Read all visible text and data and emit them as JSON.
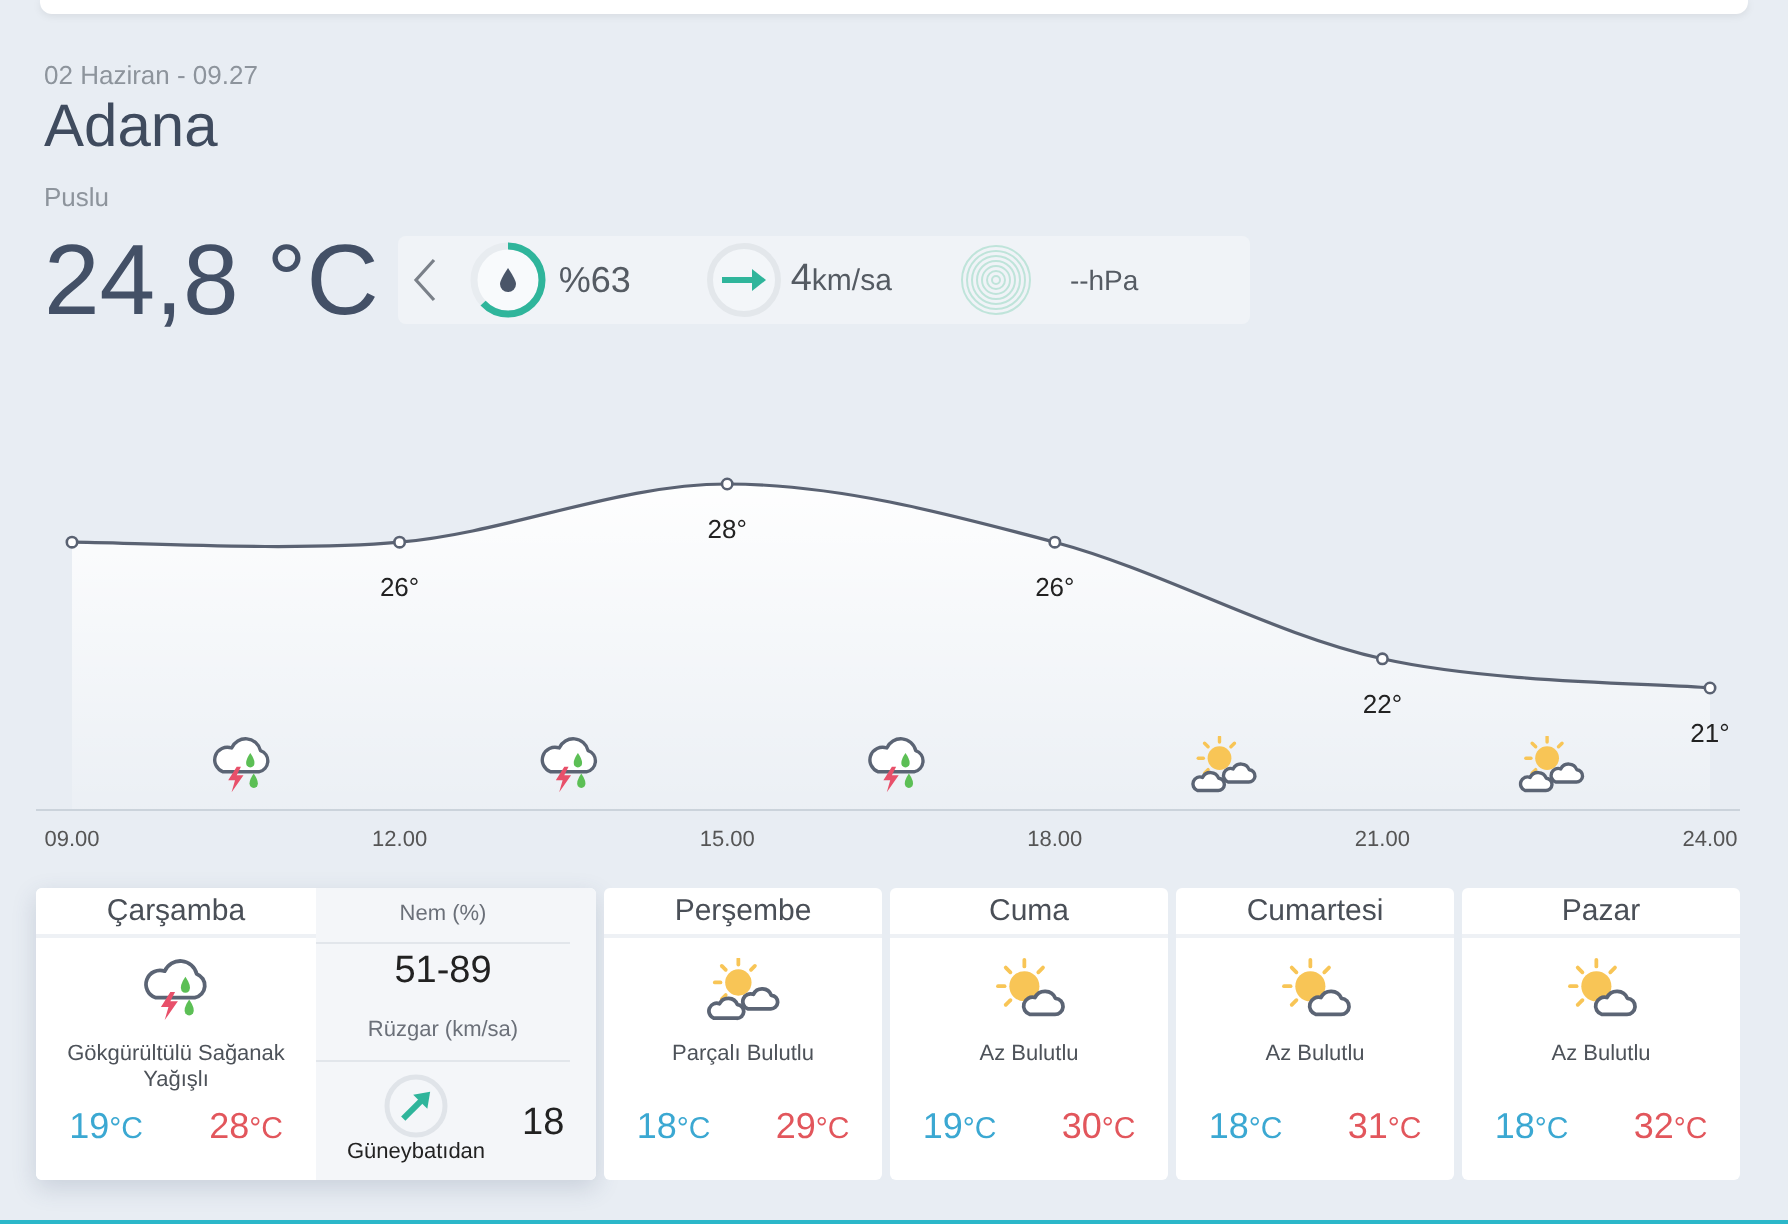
{
  "current": {
    "date_time": "02 Haziran - 09.27",
    "city": "Adana",
    "condition": "Puslu",
    "temperature": "24,8 °C"
  },
  "details": {
    "humidity": {
      "value": "%63",
      "level": 0.63
    },
    "wind": {
      "speed": "4",
      "unit": "km/sa"
    },
    "pressure": {
      "value": "--hPa"
    }
  },
  "hourly": {
    "chart_data": {
      "type": "area",
      "categories": [
        "09.00",
        "12.00",
        "15.00",
        "18.00",
        "21.00",
        "24.00"
      ],
      "values": [
        26,
        26,
        28,
        26,
        22,
        21
      ],
      "value_labels": [
        null,
        "26°",
        "28°",
        "26°",
        "22°",
        "21°"
      ]
    },
    "conditions": [
      {
        "kind": "thunderstorm"
      },
      {
        "kind": "thunderstorm"
      },
      {
        "kind": "thunderstorm"
      },
      {
        "kind": "partly_cloudy"
      },
      {
        "kind": "partly_cloudy"
      }
    ]
  },
  "today": {
    "day": "Çarşamba",
    "kind": "thunderstorm",
    "description": "Gökgürültülü Sağanak Yağışlı",
    "low": {
      "value": "19",
      "unit": "°C"
    },
    "high": {
      "value": "28",
      "unit": "°C"
    },
    "humidity_label": "Nem (%)",
    "humidity_range": "51-89",
    "wind_label": "Rüzgar (km/sa)",
    "wind_direction": "Güneybatıdan",
    "wind_speed": "18"
  },
  "forecast": [
    {
      "day": "Perşembe",
      "kind": "partly_cloudy",
      "description": "Parçalı Bulutlu",
      "low": {
        "value": "18",
        "unit": "°C"
      },
      "high": {
        "value": "29",
        "unit": "°C"
      }
    },
    {
      "day": "Cuma",
      "kind": "few_clouds",
      "description": "Az Bulutlu",
      "low": {
        "value": "19",
        "unit": "°C"
      },
      "high": {
        "value": "30",
        "unit": "°C"
      }
    },
    {
      "day": "Cumartesi",
      "kind": "few_clouds",
      "description": "Az Bulutlu",
      "low": {
        "value": "18",
        "unit": "°C"
      },
      "high": {
        "value": "31",
        "unit": "°C"
      }
    },
    {
      "day": "Pazar",
      "kind": "few_clouds",
      "description": "Az Bulutlu",
      "low": {
        "value": "18",
        "unit": "°C"
      },
      "high": {
        "value": "32",
        "unit": "°C"
      }
    }
  ]
}
